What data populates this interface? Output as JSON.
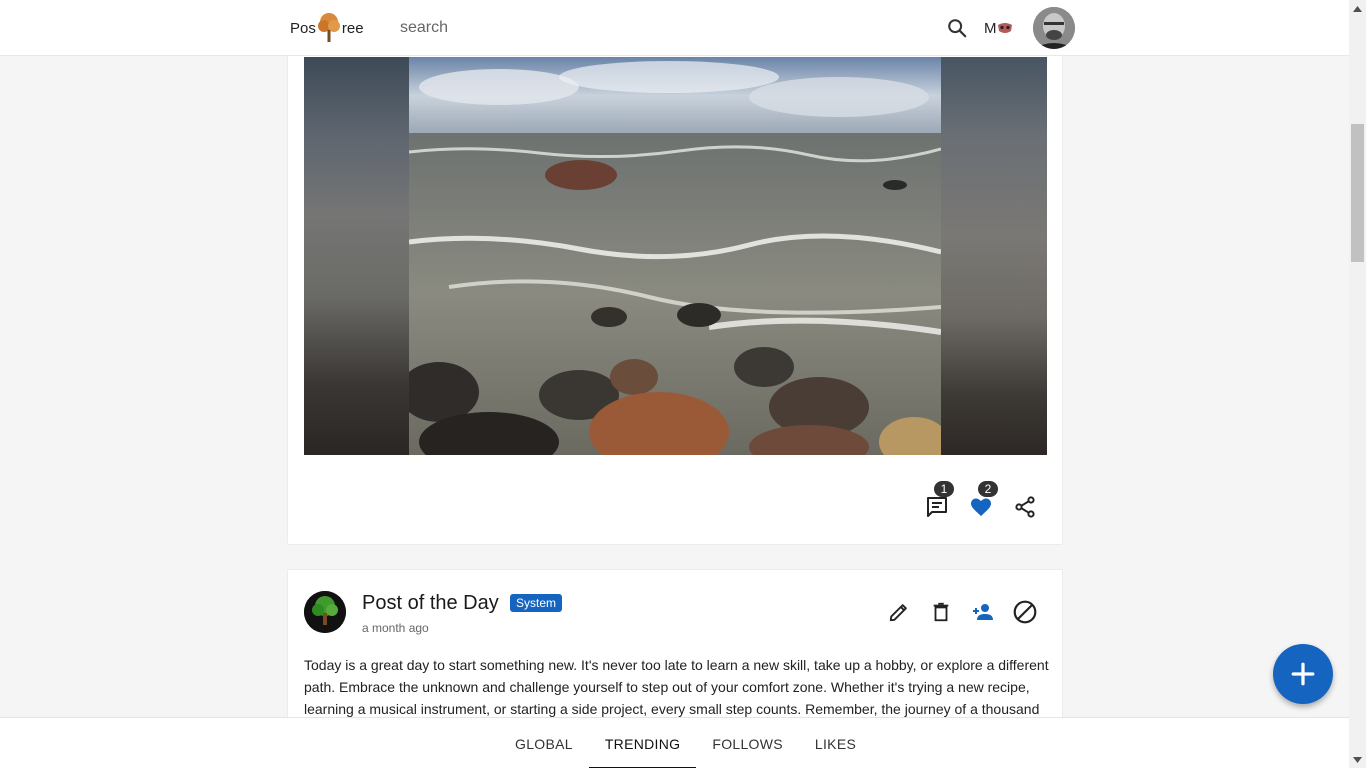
{
  "app": {
    "logo_text_left": "Pos",
    "logo_text_right": "ree",
    "logo_icon": "tree-icon"
  },
  "header": {
    "search_placeholder": "search",
    "mode_label": "M",
    "mode_icon": "mask-icon",
    "search_icon": "search-icon",
    "avatar_icon": "user-avatar"
  },
  "post1": {
    "image_icon": "photo-stormy-sea-rocks",
    "comments_count": "1",
    "likes_count": "2",
    "icons": [
      "comment-icon",
      "heart-icon",
      "share-icon"
    ],
    "accent_color": "#1565c0"
  },
  "post2": {
    "title": "Post of the Day",
    "badge": "System",
    "time": "a month ago",
    "body": "Today is a great day to start something new. It's never too late to learn a new skill, take up a hobby, or explore a different path. Embrace the unknown and challenge yourself to step out of your comfort zone. Whether it's trying a new recipe, learning a musical instrument, or starting a side project, every small step counts. Remember, the journey of a thousand",
    "tool_icons": [
      "pencil-icon",
      "trash-icon",
      "person-add-icon",
      "block-icon"
    ]
  },
  "fab": {
    "icon": "plus-icon"
  },
  "tabs": [
    {
      "label": "GLOBAL",
      "active": false
    },
    {
      "label": "TRENDING",
      "active": true
    },
    {
      "label": "FOLLOWS",
      "active": false
    },
    {
      "label": "LIKES",
      "active": false
    }
  ]
}
